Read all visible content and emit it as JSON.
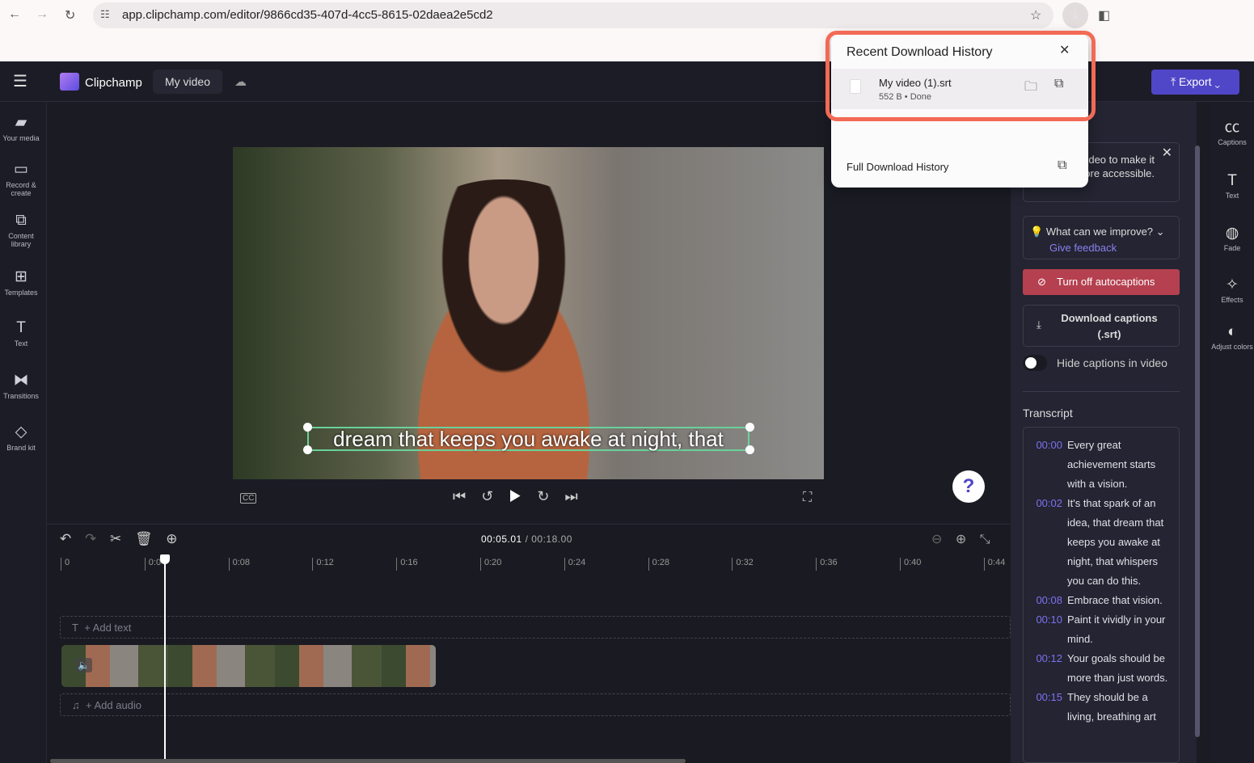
{
  "browser": {
    "url": "app.clipchamp.com/editor/9866cd35-407d-4cc5-8615-02daea2e5cd2"
  },
  "app": {
    "brand": "Clipchamp",
    "project_title": "My video",
    "export_label": "Export"
  },
  "sidebar": {
    "items": [
      {
        "label": "Your media",
        "icon": "folder-icon"
      },
      {
        "label": "Record & create",
        "icon": "camera-icon"
      },
      {
        "label": "Content library",
        "icon": "library-icon"
      },
      {
        "label": "Templates",
        "icon": "templates-icon"
      },
      {
        "label": "Text",
        "icon": "text-icon"
      },
      {
        "label": "Transitions",
        "icon": "transitions-icon"
      },
      {
        "label": "Brand kit",
        "icon": "brand-kit-icon"
      }
    ]
  },
  "preview": {
    "caption": "dream that keeps you awake at night, that"
  },
  "timeline": {
    "current": "00:05.01",
    "total": "/ 00:18.00",
    "ticks": [
      "0",
      "0:04",
      "0:08",
      "0:12",
      "0:16",
      "0:20",
      "0:24",
      "0:28",
      "0:32",
      "0:36",
      "0:40",
      "0:44"
    ],
    "add_text": "+ Add text",
    "add_audio": "+ Add audio",
    "playhead_seconds": 5.01
  },
  "popup": {
    "title": "Recent Download History",
    "file_name": "My video (1).srt",
    "file_meta": "552 B • Done",
    "full_history": "Full Download History"
  },
  "captions_panel": {
    "tip_text": "ptions to deo to make it more accessible.",
    "feedback_question": "What can we improve?",
    "feedback_link": "Give feedback",
    "turn_off": "Turn off autocaptions",
    "download_line1": "Download captions",
    "download_line2": "(.srt)",
    "hide_toggle": "Hide captions in video",
    "hide_toggle_on": false,
    "transcript_label": "Transcript",
    "transcript": [
      {
        "t": "00:00",
        "text": "Every great achievement starts with a vision."
      },
      {
        "t": "00:02",
        "text": "It's that spark of an idea, that dream that keeps you awake at night, that whispers you can do this."
      },
      {
        "t": "00:08",
        "text": "Embrace that vision."
      },
      {
        "t": "00:10",
        "text": "Paint it vividly in your mind."
      },
      {
        "t": "00:12",
        "text": "Your goals should be more than just words."
      },
      {
        "t": "00:15",
        "text": "They should be a living, breathing art"
      }
    ]
  },
  "right_rail": {
    "items": [
      {
        "label": "Captions"
      },
      {
        "label": "Text"
      },
      {
        "label": "Fade"
      },
      {
        "label": "Effects"
      },
      {
        "label": "Adjust colors"
      }
    ]
  },
  "colors": {
    "accent": "#4f46c8",
    "danger": "#b5404f",
    "highlight": "#f26a55",
    "timestamp": "#7c72f0"
  }
}
